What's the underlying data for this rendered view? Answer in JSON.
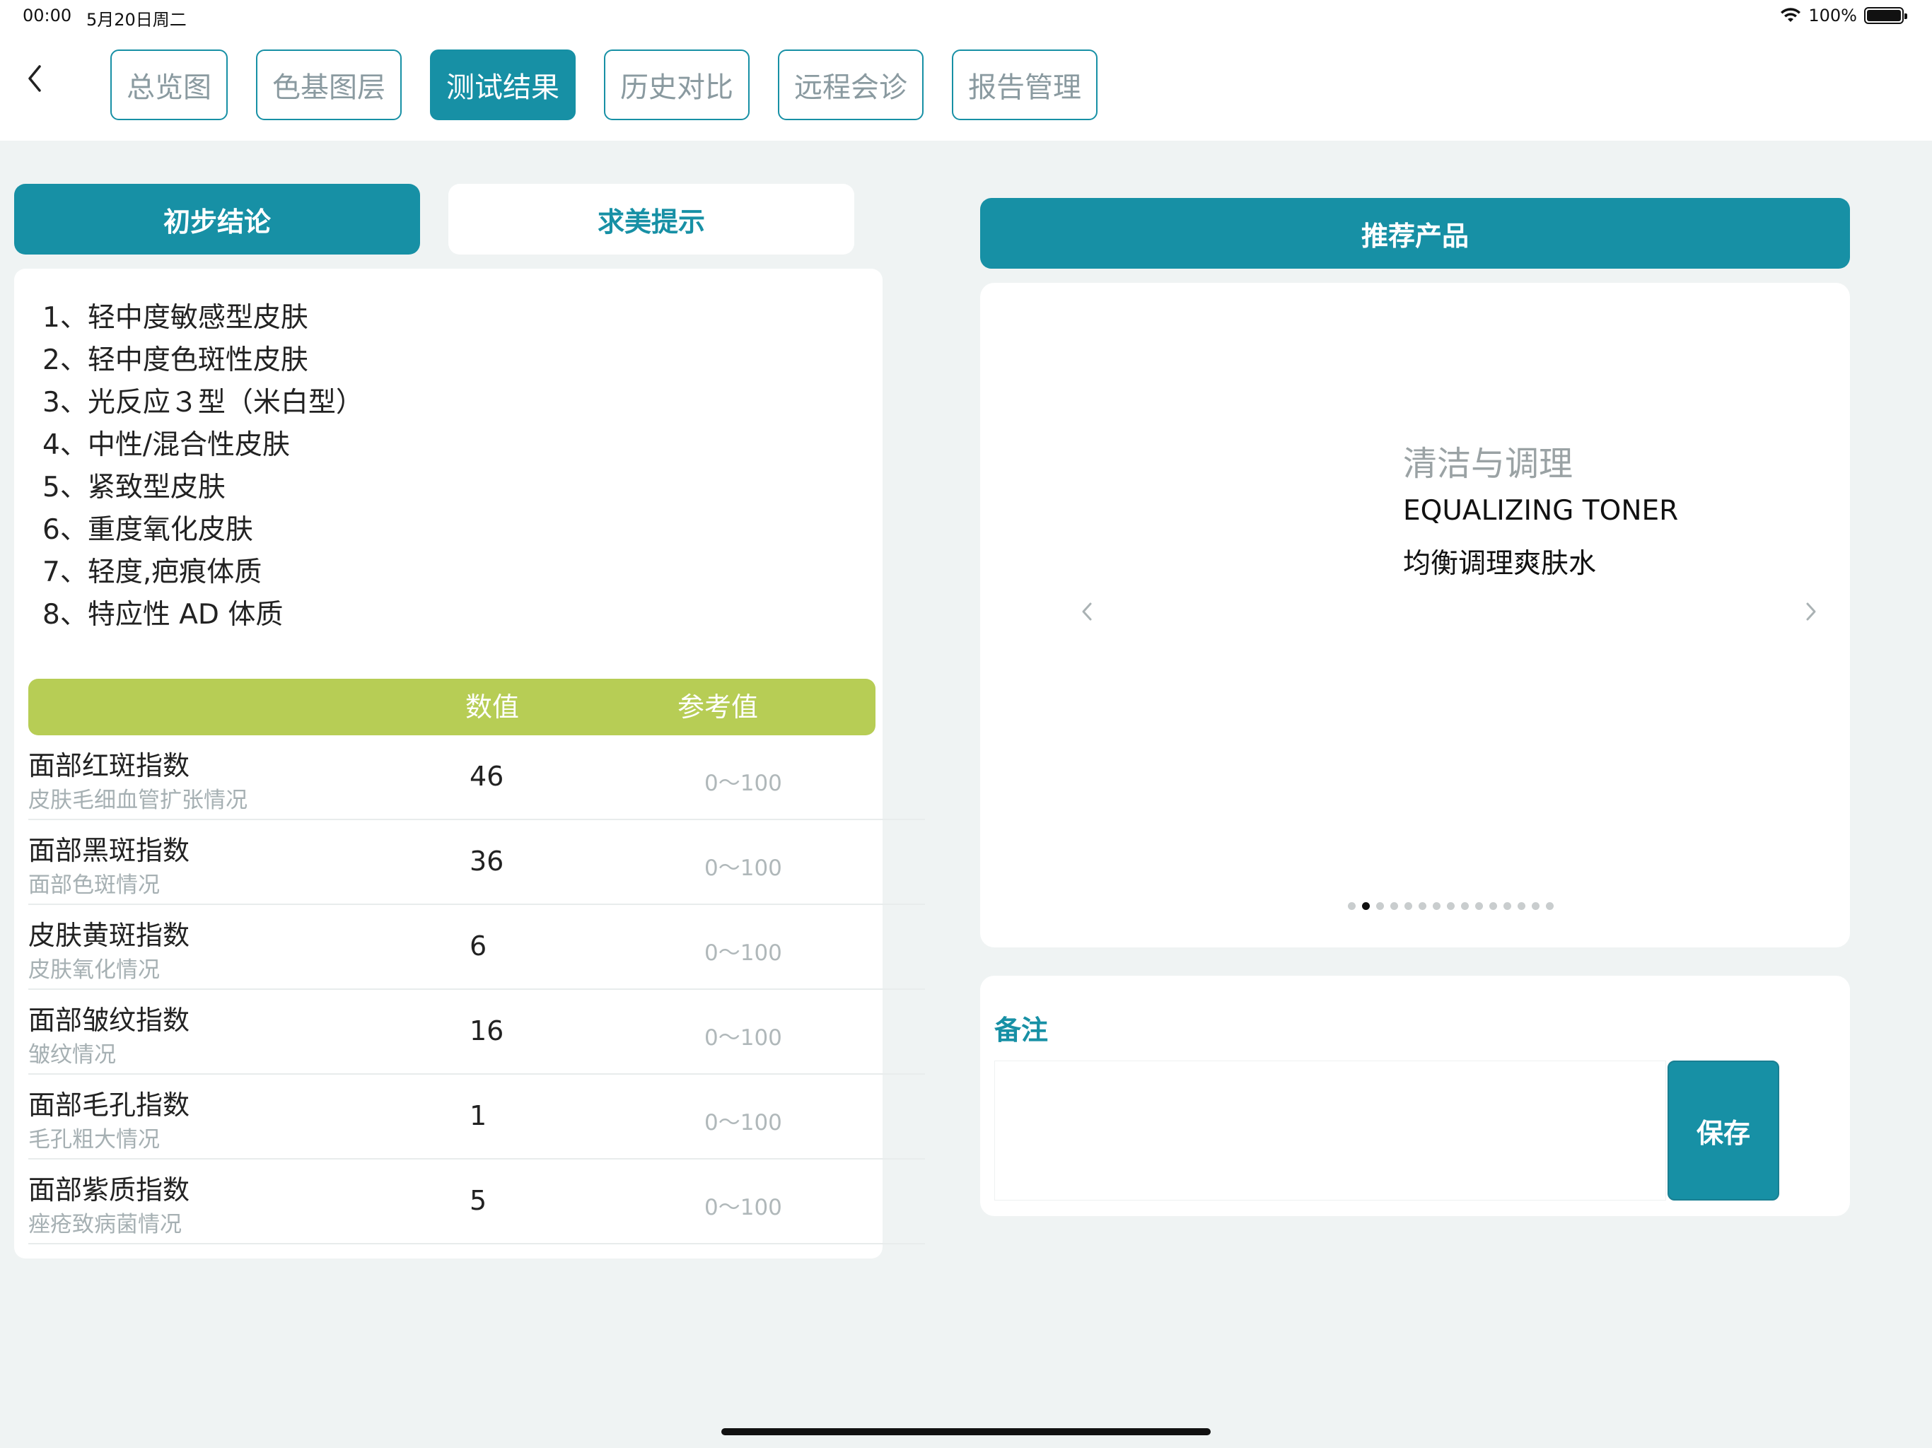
{
  "status_bar": {
    "time": "00:00",
    "date": "5月20日周二",
    "battery": "100%"
  },
  "nav": {
    "tabs": [
      {
        "label": "总览图"
      },
      {
        "label": "色基图层"
      },
      {
        "label": "测试结果"
      },
      {
        "label": "历史对比"
      },
      {
        "label": "远程会诊"
      },
      {
        "label": "报告管理"
      }
    ],
    "active_index": 2
  },
  "left": {
    "tabs": [
      {
        "label": "初步结论"
      },
      {
        "label": "求美提示"
      }
    ],
    "conclusions": [
      "1、轻中度敏感型皮肤",
      "2、轻中度色斑性皮肤",
      "3、光反应３型（米白型）",
      "4、中性/混合性皮肤",
      "5、紧致型皮肤",
      "6、重度氧化皮肤",
      "7、轻度,疤痕体质",
      "8、特应性 AD 体质"
    ],
    "table": {
      "headers": {
        "value": "数值",
        "reference": "参考值"
      },
      "rows": [
        {
          "name": "面部红斑指数",
          "desc": "皮肤毛细血管扩张情况",
          "value": "46",
          "ref": "0～100"
        },
        {
          "name": "面部黑斑指数",
          "desc": "面部色斑情况",
          "value": "36",
          "ref": "0～100"
        },
        {
          "name": "皮肤黄斑指数",
          "desc": "皮肤氧化情况",
          "value": "6",
          "ref": "0～100"
        },
        {
          "name": "面部皱纹指数",
          "desc": "皱纹情况",
          "value": "16",
          "ref": "0～100"
        },
        {
          "name": "面部毛孔指数",
          "desc": "毛孔粗大情况",
          "value": "1",
          "ref": "0～100"
        },
        {
          "name": "面部紫质指数",
          "desc": "痤疮致病菌情况",
          "value": "5",
          "ref": "0～100"
        }
      ]
    }
  },
  "right": {
    "recommend_title": "推荐产品",
    "product": {
      "category": "清洁与调理",
      "name_en": "EQUALIZING TONER",
      "name_cn": "均衡调理爽肤水"
    },
    "carousel": {
      "count": 15,
      "active": 1
    },
    "notes": {
      "label": "备注",
      "value": "",
      "save_label": "保存"
    }
  },
  "colors": {
    "primary": "#1790a5",
    "table_header": "#b7cd55",
    "background": "#eff3f3"
  },
  "icons": {
    "back": "chevron-left-icon",
    "prev": "chevron-left-icon",
    "next": "chevron-right-icon",
    "wifi": "wifi-icon",
    "battery": "battery-icon"
  }
}
